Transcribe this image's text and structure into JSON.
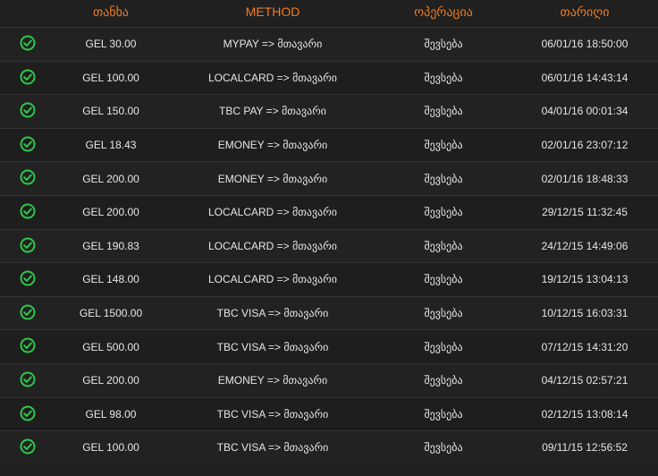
{
  "header": {
    "amount": "თანხა",
    "method": "METHOD",
    "operation": "ოპერაცია",
    "date": "თარიღი"
  },
  "colors": {
    "header": "#f07d1e",
    "check": "#2ec84a",
    "text": "#e6e6e6",
    "background": "#202020"
  },
  "rows": [
    {
      "icon": "check-circle-icon",
      "amount": "GEL 30.00",
      "method": "MYPAY => მთავარი",
      "operation": "შევსება",
      "date": "06/01/16 18:50:00"
    },
    {
      "icon": "check-circle-icon",
      "amount": "GEL 100.00",
      "method": "LOCALCARD => მთავარი",
      "operation": "შევსება",
      "date": "06/01/16 14:43:14"
    },
    {
      "icon": "check-circle-icon",
      "amount": "GEL 150.00",
      "method": "TBC PAY => მთავარი",
      "operation": "შევსება",
      "date": "04/01/16 00:01:34"
    },
    {
      "icon": "check-circle-icon",
      "amount": "GEL 18.43",
      "method": "EMONEY => მთავარი",
      "operation": "შევსება",
      "date": "02/01/16 23:07:12"
    },
    {
      "icon": "check-circle-icon",
      "amount": "GEL 200.00",
      "method": "EMONEY => მთავარი",
      "operation": "შევსება",
      "date": "02/01/16 18:48:33"
    },
    {
      "icon": "check-circle-icon",
      "amount": "GEL 200.00",
      "method": "LOCALCARD => მთავარი",
      "operation": "შევსება",
      "date": "29/12/15 11:32:45"
    },
    {
      "icon": "check-circle-icon",
      "amount": "GEL 190.83",
      "method": "LOCALCARD => მთავარი",
      "operation": "შევსება",
      "date": "24/12/15 14:49:06"
    },
    {
      "icon": "check-circle-icon",
      "amount": "GEL 148.00",
      "method": "LOCALCARD => მთავარი",
      "operation": "შევსება",
      "date": "19/12/15 13:04:13"
    },
    {
      "icon": "check-circle-icon",
      "amount": "GEL 1500.00",
      "method": "TBC VISA => მთავარი",
      "operation": "შევსება",
      "date": "10/12/15 16:03:31"
    },
    {
      "icon": "check-circle-icon",
      "amount": "GEL 500.00",
      "method": "TBC VISA => მთავარი",
      "operation": "შევსება",
      "date": "07/12/15 14:31:20"
    },
    {
      "icon": "check-circle-icon",
      "amount": "GEL 200.00",
      "method": "EMONEY => მთავარი",
      "operation": "შევსება",
      "date": "04/12/15 02:57:21"
    },
    {
      "icon": "check-circle-icon",
      "amount": "GEL 98.00",
      "method": "TBC VISA => მთავარი",
      "operation": "შევსება",
      "date": "02/12/15 13:08:14"
    },
    {
      "icon": "check-circle-icon",
      "amount": "GEL 100.00",
      "method": "TBC VISA => მთავარი",
      "operation": "შევსება",
      "date": "09/11/15 12:56:52"
    }
  ]
}
